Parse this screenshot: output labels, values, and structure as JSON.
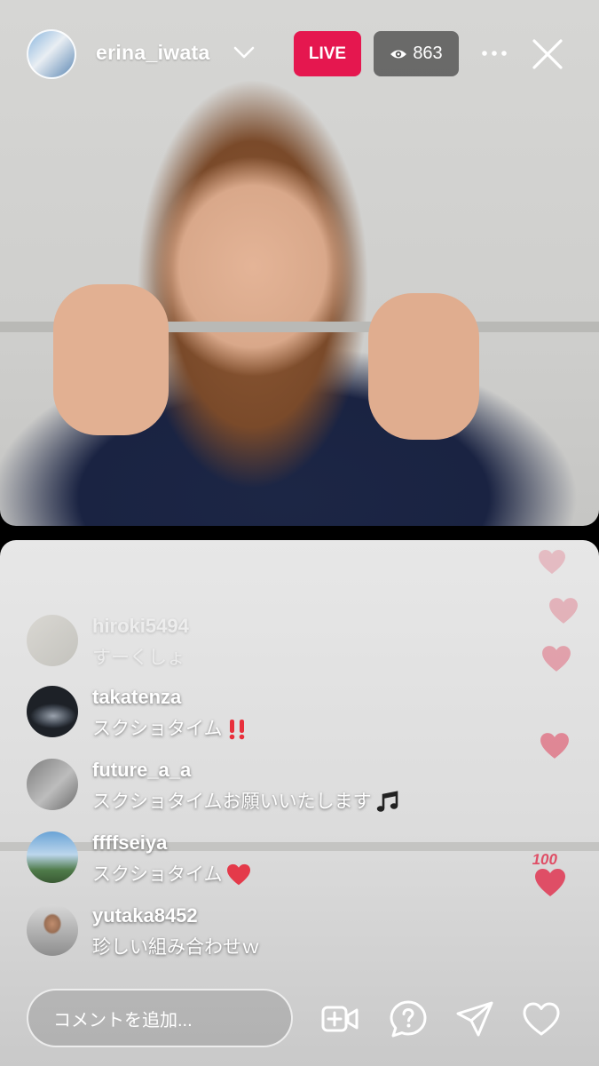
{
  "header": {
    "host_username": "erina_iwata",
    "live_label": "LIVE",
    "viewer_count": "863"
  },
  "comments": [
    {
      "username": "hiroki5494",
      "text": "すーくしょ",
      "faded": true
    },
    {
      "username": "takatenza",
      "text": "スクショタイム",
      "emoji": "double-exclamation"
    },
    {
      "username": "future_a_a",
      "text": "スクショタイムお願いいたします",
      "emoji": "music-notes"
    },
    {
      "username": "ffffseiya",
      "text": "スクショタイム",
      "emoji": "red-heart"
    },
    {
      "username": "yutaka8452",
      "text": "珍しい組み合わせｗ"
    }
  ],
  "footer": {
    "comment_placeholder": "コメントを追加..."
  },
  "icons": [
    "chevron-down-icon",
    "eye-icon",
    "more-icon",
    "close-icon",
    "add-video-icon",
    "question-icon",
    "send-icon",
    "heart-icon"
  ],
  "colors": {
    "live_badge": "#e5174f",
    "viewer_badge": "#464646",
    "heart": "#e0405a"
  }
}
